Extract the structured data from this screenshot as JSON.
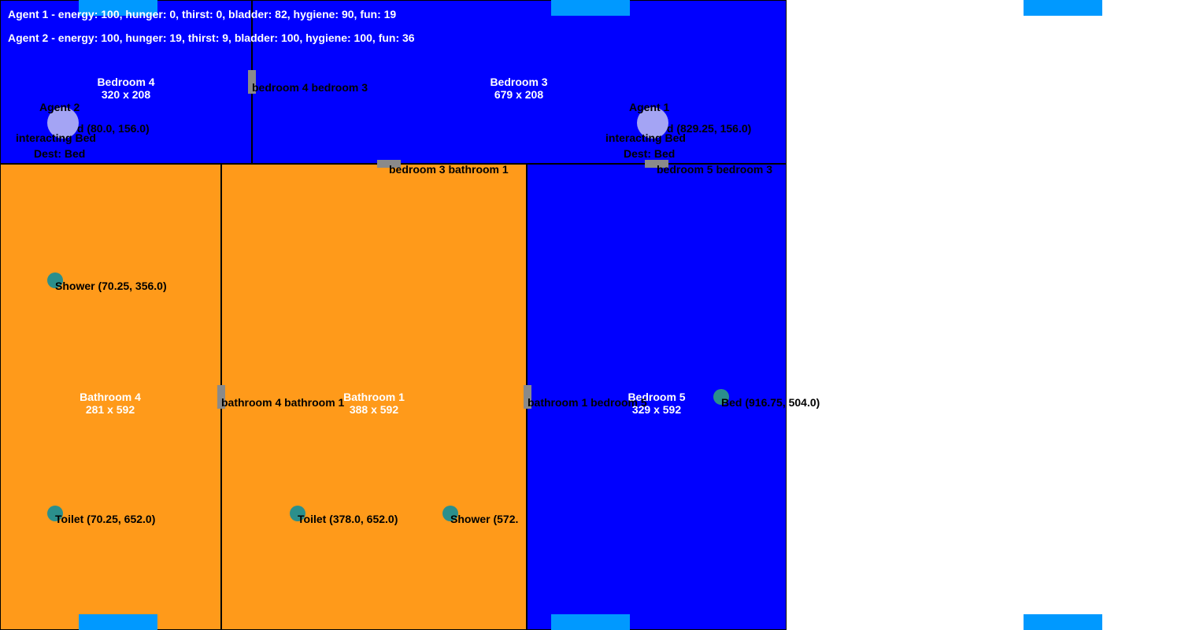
{
  "colors": {
    "bedroom": "#0000ff",
    "bathroom": "#ff9a1a",
    "door": "#8a8a8a",
    "object": "#2b8f8c",
    "agent": "#a4a4f4",
    "window": "#0099ff"
  },
  "status": {
    "agent1": "Agent 1 - energy: 100, hunger: 0, thirst: 0, bladder: 82, hygiene: 90, fun: 19",
    "agent2": "Agent 2 - energy: 100, hunger: 19, thirst: 9, bladder: 100, hygiene: 100, fun: 36"
  },
  "rooms": {
    "bedroom4": {
      "name": "Bedroom 4",
      "size": "320 x 208"
    },
    "bedroom3": {
      "name": "Bedroom 3",
      "size": "679 x 208"
    },
    "bathroom4": {
      "name": "Bathroom 4",
      "size": "281 x 592"
    },
    "bathroom1": {
      "name": "Bathroom 1",
      "size": "388 x 592"
    },
    "bedroom5": {
      "name": "Bedroom 5",
      "size": "329 x 592"
    }
  },
  "doors": {
    "d1": "bedroom 4 bedroom 3",
    "d2": "bedroom 3 bathroom 1",
    "d3": "bedroom 5 bedroom 3",
    "d4": "bathroom 4 bathroom 1",
    "d5": "bathroom 1 bedroom 5"
  },
  "objects": {
    "bed_b4": "Bed (80.0, 156.0)",
    "bed_b3": "Bed (829.25, 156.0)",
    "shower_ba4": "Shower (70.25, 356.0)",
    "toilet_ba4": "Toilet (70.25, 652.0)",
    "toilet_ba1": "Toilet (378.0, 652.0)",
    "shower_ba1": "Shower (572.",
    "bed_b5": "Bed (916.75, 504.0)"
  },
  "agents": {
    "agent1": {
      "name": "Agent 1",
      "state": "interacting Bed",
      "dest": "Dest: Bed"
    },
    "agent2": {
      "name": "Agent 2",
      "state": "interacting Bed",
      "dest": "Dest: Bed"
    }
  }
}
